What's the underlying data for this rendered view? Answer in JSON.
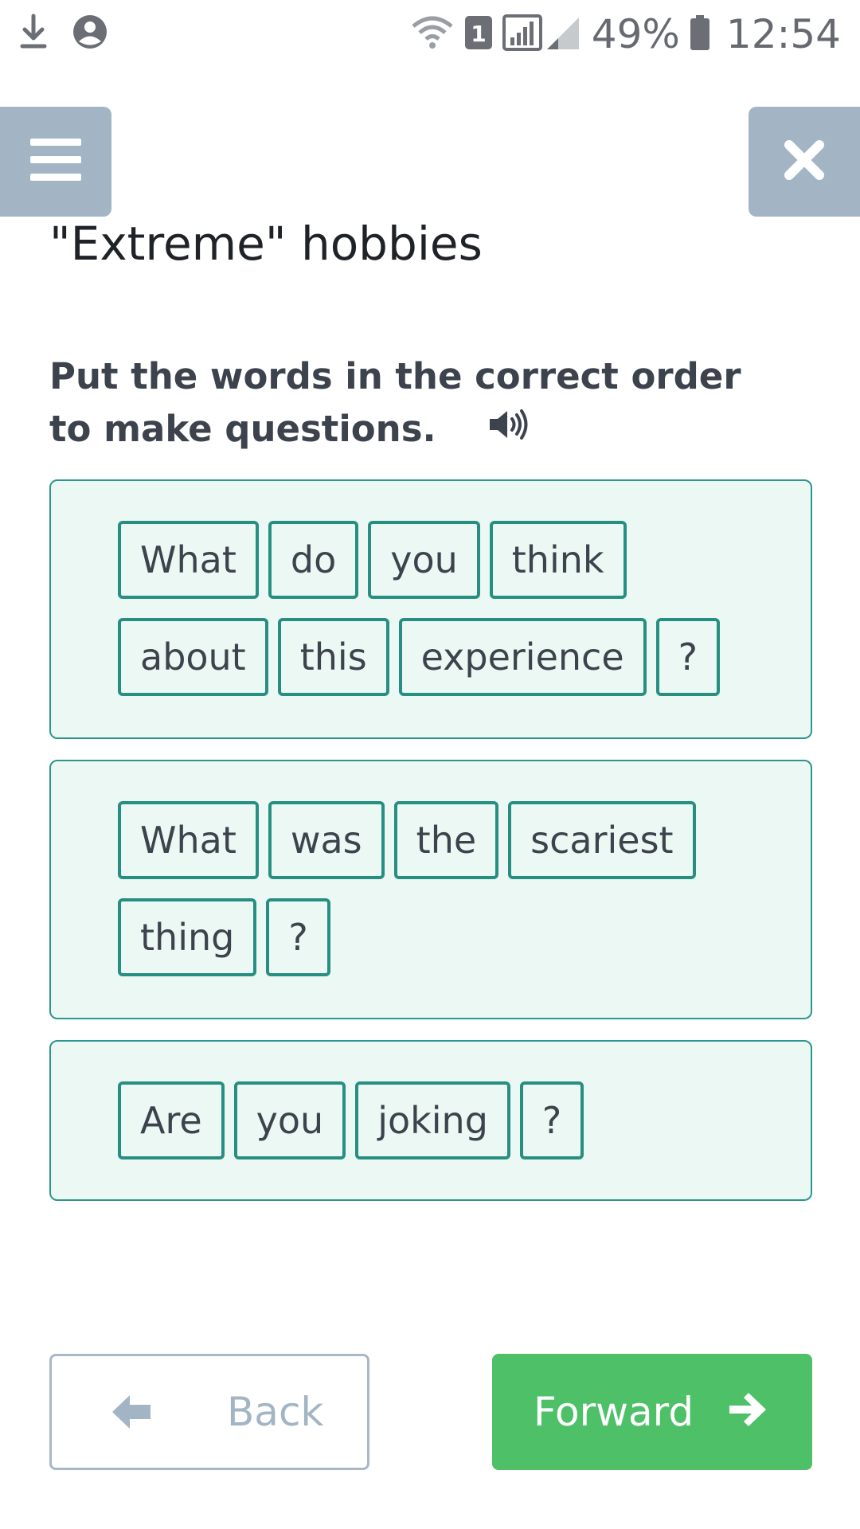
{
  "status_bar": {
    "sim_badge": "1",
    "battery": "49%",
    "time": "12:54"
  },
  "header": {
    "title": "\"Extreme\" hobbies"
  },
  "instruction": {
    "text": "Put the words in the correct order to make questions."
  },
  "sentences": [
    {
      "rows": [
        [
          "What",
          "do",
          "you",
          "think"
        ],
        [
          "about",
          "this",
          "experience",
          "?"
        ]
      ]
    },
    {
      "rows": [
        [
          "What",
          "was",
          "the",
          "scariest"
        ],
        [
          "thing",
          "?"
        ]
      ]
    },
    {
      "rows": [
        [
          "Are",
          "you",
          "joking",
          "?"
        ]
      ]
    }
  ],
  "navigation": {
    "back_label": "Back",
    "forward_label": "Forward"
  },
  "colors": {
    "header_button": "#a3b5c4",
    "card_background": "#ecf8f3",
    "card_border": "#2b968b",
    "word_border": "#268f82",
    "forward_button": "#4ec068"
  },
  "icons": [
    "download-icon",
    "account-icon",
    "wifi-icon",
    "sim-icon",
    "signal-icon",
    "battery-icon",
    "menu-icon",
    "close-icon",
    "speaker-icon",
    "arrow-left-icon",
    "arrow-right-icon"
  ]
}
